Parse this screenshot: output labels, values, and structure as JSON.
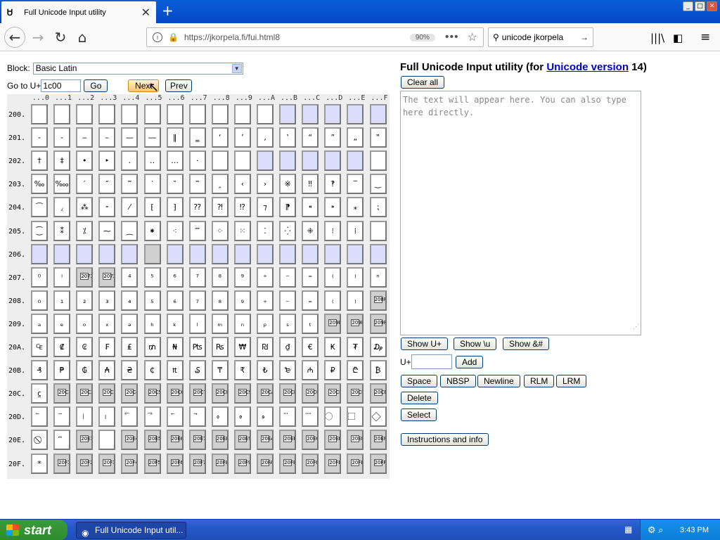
{
  "browser": {
    "tab_title": "Full Unicode Input utility",
    "url": "https://jkorpela.fi/fui.html8",
    "zoom": "90%",
    "search_value": "unicode jkorpela"
  },
  "form": {
    "block_label": "Block:",
    "block_value": "Basic Latin",
    "goto_label": "Go to U+",
    "goto_value": "1c00",
    "go_label": "Go",
    "next_label": "Next",
    "prev_label": "Prev"
  },
  "grid": {
    "col_headers": [
      "...0",
      "...1",
      "...2",
      "...3",
      "...4",
      "...5",
      "...6",
      "...7",
      "...8",
      "...9",
      "...A",
      "...B",
      "...C",
      "...D",
      "...E",
      "...F"
    ],
    "rows": [
      {
        "label": "200.",
        "cells": [
          " ",
          " ",
          " ",
          " ",
          " ",
          " ",
          " ",
          " ",
          " ",
          " ",
          " ",
          " ",
          "",
          "",
          "",
          ""
        ],
        "types": "wwwwwwwwwwwbbbbb"
      },
      {
        "label": "201.",
        "cells": [
          "‐",
          "‑",
          "‒",
          "–",
          "—",
          "―",
          "‖",
          "‗",
          "‘",
          "’",
          "‚",
          "‛",
          "“",
          "”",
          "„",
          "‟"
        ],
        "types": "wwwwwwwwwwwwwwww"
      },
      {
        "label": "202.",
        "cells": [
          "†",
          "‡",
          "•",
          "‣",
          "․",
          "‥",
          "…",
          "‧",
          "",
          "",
          "",
          "",
          "",
          "",
          "",
          " "
        ],
        "types": "wwwwwwwwwwbbbbbw"
      },
      {
        "label": "203.",
        "cells": [
          "‰",
          "‱",
          "′",
          "″",
          "‴",
          "‵",
          "‶",
          "‷",
          "‸",
          "‹",
          "›",
          "※",
          "‼",
          "‽",
          "‾",
          "‿"
        ],
        "types": "wwwwwwwwwwwwwwww"
      },
      {
        "label": "204.",
        "cells": [
          "⁀",
          "⁁",
          "⁂",
          "⁃",
          "⁄",
          "⁅",
          "⁆",
          "⁇",
          "⁈",
          "⁉",
          "⁊",
          "⁋",
          "⁌",
          "⁍",
          "⁎",
          "⁏"
        ],
        "types": "wwwwwwwwwwwwwwww"
      },
      {
        "label": "205.",
        "cells": [
          "⁐",
          "⁑",
          "⁒",
          "⁓",
          "⁔",
          "⁕",
          "⁖",
          "⁗",
          "⁘",
          "⁙",
          "⁚",
          "⁛",
          "⁜",
          "⁝",
          "⁞",
          " "
        ],
        "types": "wwwwwwwwwwwwwwww"
      },
      {
        "label": "206.",
        "cells": [
          "",
          "",
          "",
          "",
          "",
          "",
          "",
          "",
          "",
          "",
          "",
          "",
          "",
          "",
          "",
          ""
        ],
        "types": "bbbbbgbbbbbbbbbb"
      },
      {
        "label": "207.",
        "cells": [
          "⁰",
          "ⁱ",
          "2072",
          "2073",
          "⁴",
          "⁵",
          "⁶",
          "⁷",
          "⁸",
          "⁹",
          "⁺",
          "⁻",
          "⁼",
          "⁽",
          "⁾",
          "ⁿ"
        ],
        "types": "wwuuwwwwwwwwwwww"
      },
      {
        "label": "208.",
        "cells": [
          "₀",
          "₁",
          "₂",
          "₃",
          "₄",
          "₅",
          "₆",
          "₇",
          "₈",
          "₉",
          "₊",
          "₋",
          "₌",
          "₍",
          "₎",
          "208F"
        ],
        "types": "wwwwwwwwwwwwwwwu"
      },
      {
        "label": "209.",
        "cells": [
          "ₐ",
          "ₑ",
          "ₒ",
          "ₓ",
          "ₔ",
          "ₕ",
          "ₖ",
          "ₗ",
          "ₘ",
          "ₙ",
          "ₚ",
          "ₛ",
          "ₜ",
          "209D",
          "209E",
          "209F"
        ],
        "types": "wwwwwwwwwwwwwuuu"
      },
      {
        "label": "20A.",
        "cells": [
          "₠",
          "₡",
          "₢",
          "₣",
          "₤",
          "₥",
          "₦",
          "₧",
          "₨",
          "₩",
          "₪",
          "₫",
          "€",
          "₭",
          "₮",
          "₯"
        ],
        "types": "wwwwwwwwwwwwwwww"
      },
      {
        "label": "20B.",
        "cells": [
          "₰",
          "₱",
          "₲",
          "₳",
          "₴",
          "₵",
          "₶",
          "₷",
          "₸",
          "₹",
          "₺",
          "₻",
          "₼",
          "₽",
          "₾",
          "₿"
        ],
        "types": "wwwwwwwwwwwwwwww"
      },
      {
        "label": "20C.",
        "cells": [
          "⃀",
          "20C1",
          "20C2",
          "20C3",
          "20C4",
          "20C5",
          "20C6",
          "20C7",
          "20C8",
          "20C9",
          "20CA",
          "20CB",
          "20CC",
          "20CD",
          "20CE",
          "20CF"
        ],
        "types": "wuuuuuuuuuuuuuuu"
      },
      {
        "label": "20D.",
        "cells": [
          "⃐",
          "⃑",
          "⃒",
          "⃓",
          "⃔",
          "⃕",
          "⃖",
          "⃗",
          "⃘",
          "⃙",
          "⃚",
          "⃛",
          "⃜",
          "⃝",
          "⃞",
          "⃟"
        ],
        "types": "wwwwwwwwwwwwwwww"
      },
      {
        "label": "20E.",
        "cells": [
          "⃠",
          "⃡",
          "20E2",
          " ",
          "20E4",
          "20E5",
          "20E6",
          "20E7",
          "20E8",
          "20E9",
          "20EA",
          "20EB",
          "20EC",
          "20ED",
          "20EE",
          "20EF"
        ],
        "types": "wwuwuuuuuuuuuuuu"
      },
      {
        "label": "20F.",
        "cells": [
          "*",
          "20F1",
          "20F2",
          "20F3",
          "20F4",
          "20F5",
          "20F6",
          "20F7",
          "20F8",
          "20F9",
          "20FA",
          "20FB",
          "20FC",
          "20FD",
          "20FE",
          "20FF"
        ],
        "types": "wuuuuuuuuuuuuuuu"
      }
    ]
  },
  "right": {
    "title_prefix": "Full Unicode Input utility (for ",
    "title_link": "Unicode version",
    "title_suffix": " 14)",
    "clear_label": "Clear all",
    "placeholder": "The text will appear here. You can also type here directly.",
    "show_u_label": "Show U+",
    "show_bs_label": "Show \\u",
    "show_amp_label": "Show &#",
    "uplus_label": "U+",
    "add_label": "Add",
    "space_label": "Space",
    "nbsp_label": "NBSP",
    "newline_label": "Newline",
    "rlm_label": "RLM",
    "lrm_label": "LRM",
    "delete_label": "Delete",
    "select_label": "Select",
    "instructions_label": "Instructions and info"
  },
  "taskbar": {
    "start_label": "start",
    "task_label": "Full Unicode Input util...",
    "clock": "3:43 PM"
  }
}
